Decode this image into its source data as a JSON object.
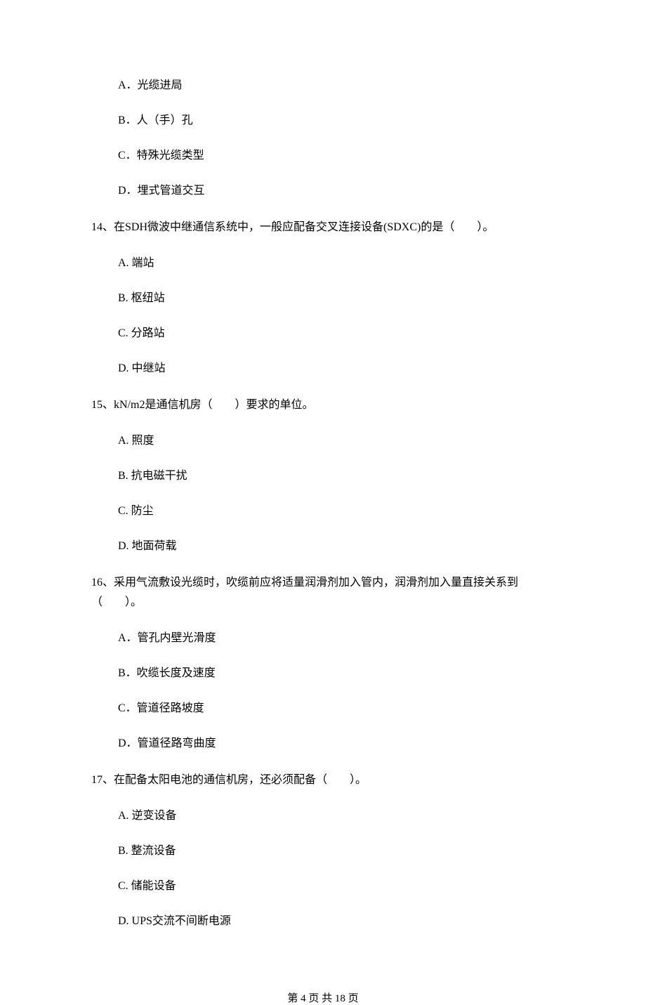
{
  "q13_options": {
    "a": "A．光缆进局",
    "b": "B．人（手）孔",
    "c": "C．特殊光缆类型",
    "d": "D．埋式管道交互"
  },
  "q14": {
    "stem": "14、在SDH微波中继通信系统中，一般应配备交叉连接设备(SDXC)的是（　　）。",
    "a": "A.  端站",
    "b": "B.  枢纽站",
    "c": "C.  分路站",
    "d": "D.  中继站"
  },
  "q15": {
    "stem": "15、kN/m2是通信机房（　　）要求的单位。",
    "a": "A.  照度",
    "b": "B.  抗电磁干扰",
    "c": "C.  防尘",
    "d": "D.  地面荷载"
  },
  "q16": {
    "stem": "16、采用气流敷设光缆时，吹缆前应将适量润滑剂加入管内，润滑剂加入量直接关系到（　　）。",
    "a": "A．管孔内壁光滑度",
    "b": "B．吹缆长度及速度",
    "c": "C．管道径路坡度",
    "d": "D．管道径路弯曲度"
  },
  "q17": {
    "stem": "17、在配备太阳电池的通信机房，还必须配备（　　）。",
    "a": "A.  逆变设备",
    "b": "B.  整流设备",
    "c": "C.  储能设备",
    "d": "D.  UPS交流不间断电源"
  },
  "footer": "第 4 页 共 18 页"
}
